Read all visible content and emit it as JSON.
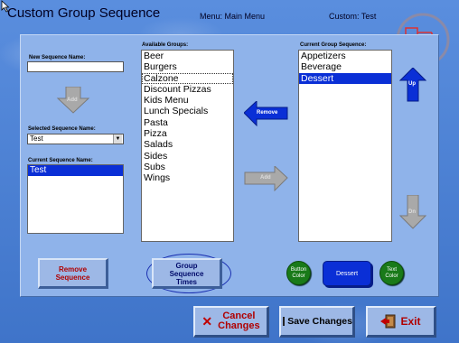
{
  "header": {
    "title": "Custom Group Sequence",
    "menu_text": "Menu:  Main Menu",
    "custom_text": "Custom:  Test"
  },
  "left": {
    "new_seq_label": "New Sequence Name:",
    "new_seq_value": "",
    "add_label": "Add",
    "selected_label": "Selected Sequence Name:",
    "selected_value": "Test",
    "current_name_label": "Current Sequence Name:",
    "current_names": [
      "Test"
    ]
  },
  "available": {
    "label": "Available Groups:",
    "items": [
      "Beer",
      "Burgers",
      "Calzone",
      "Discount Pizzas",
      "Kids Menu",
      "Lunch Specials",
      "Pasta",
      "Pizza",
      "Salads",
      "Sides",
      "Subs",
      "Wings"
    ]
  },
  "current_group": {
    "label": "Current Group Sequence:",
    "items": [
      "Appetizers",
      "Beverage",
      "Dessert"
    ]
  },
  "arrows": {
    "remove": "Remove",
    "add": "Add",
    "up": "Up",
    "dn": "Dn"
  },
  "buttons": {
    "remove_sequence_1": "Remove",
    "remove_sequence_2": "Sequence",
    "group_times_1": "Group",
    "group_times_2": "Sequence",
    "group_times_3": "Times",
    "button_color_1": "Button",
    "button_color_2": "Color",
    "dessert": "Dessert",
    "text_color_1": "Text",
    "text_color_2": "Color",
    "cancel_1": "Cancel",
    "cancel_2": "Changes",
    "save": "Save Changes",
    "exit": "Exit"
  },
  "colors": {
    "accent": "#0a2fd6",
    "danger_text": "#b00000",
    "green": "#197a19"
  }
}
